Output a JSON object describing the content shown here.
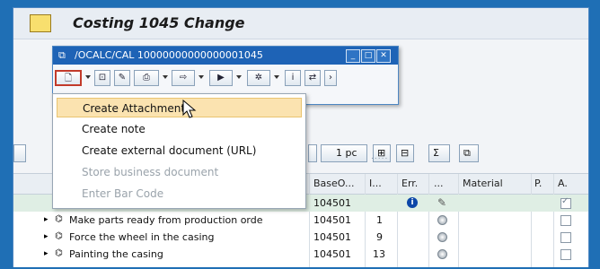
{
  "window": {
    "title": "Costing 1045 Change"
  },
  "dialog": {
    "title": "/OCALC/CAL 10000000000000001045",
    "window_buttons": [
      "minimize-icon",
      "maximize-icon",
      "close-icon"
    ]
  },
  "menu": {
    "items": [
      {
        "label": "Create Attachment",
        "state": "hover"
      },
      {
        "label": "Create note",
        "state": "enabled"
      },
      {
        "label": "Create external document (URL)",
        "state": "enabled"
      },
      {
        "label": "Store business document",
        "state": "disabled"
      },
      {
        "label": "Enter Bar Code",
        "state": "disabled"
      }
    ]
  },
  "toolbar": {
    "unit_label": "1 pc"
  },
  "table": {
    "headers": [
      "BaseO...",
      "I...",
      "Err.",
      "...",
      "Material",
      "P.",
      "A."
    ],
    "rows": [
      {
        "text": "",
        "base": "104501",
        "item": "",
        "icon": "info",
        "state": "pencil",
        "checked": true
      },
      {
        "text": "Make parts ready from production orde",
        "base": "104501",
        "item": "1",
        "icon": "",
        "state": "grey",
        "checked": false
      },
      {
        "text": "Force the wheel in the casing",
        "base": "104501",
        "item": "9",
        "icon": "",
        "state": "grey",
        "checked": false
      },
      {
        "text": "Painting the casing",
        "base": "104501",
        "item": "13",
        "icon": "",
        "state": "grey",
        "checked": false
      }
    ]
  },
  "colors": {
    "accent": "#1e63b6",
    "hover": "#fbe3b0",
    "selected_row": "#dfeee4"
  }
}
